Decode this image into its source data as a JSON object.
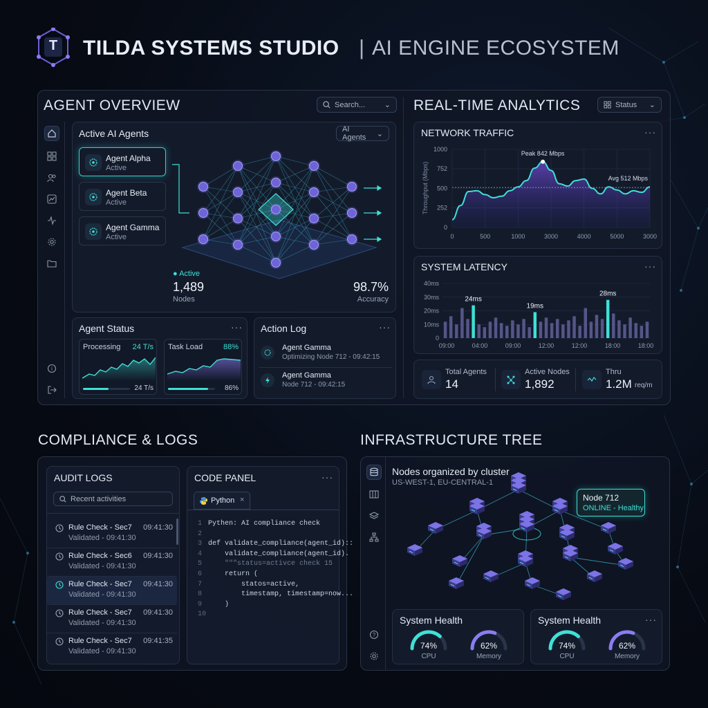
{
  "header": {
    "brand": "TILDA SYSTEMS STUDIO",
    "separator": "|",
    "subtitle": "AI ENGINE ECOSYSTEM",
    "logo_letter": "T"
  },
  "agent_overview": {
    "title": "AGENT OVERVIEW",
    "search_placeholder": "Search...",
    "active_agents_title": "Active AI Agents",
    "filter_label": "AI Agents",
    "agents": [
      {
        "name": "Agent Alpha",
        "state": "Active"
      },
      {
        "name": "Agent Beta",
        "state": "Active"
      },
      {
        "name": "Agent Gamma",
        "state": "Active"
      }
    ],
    "active_label": "Active",
    "nodes_value": "1,489",
    "nodes_label": "Nodes",
    "accuracy_value": "98.7%",
    "accuracy_label": "Accuracy"
  },
  "agent_status": {
    "title": "Agent Status",
    "processing": {
      "label": "Processing",
      "value": "24 T/s",
      "footer": "24 T/s",
      "fill": 0.55
    },
    "task_load": {
      "label": "Task Load",
      "value": "88%",
      "footer": "86%",
      "fill": 0.86
    }
  },
  "action_log": {
    "title": "Action Log",
    "entries": [
      {
        "name": "Agent Gamma",
        "detail": "Optimizing Node 712 - 09:42:15"
      },
      {
        "name": "Agent Gamma",
        "detail": "Node 712 - 09:42:15"
      }
    ]
  },
  "analytics": {
    "title": "REAL-TIME ANALYTICS",
    "status_label": "Status"
  },
  "network_traffic": {
    "title": "NETWORK TRAFFIC",
    "ylabel": "Throughput (Mbps)",
    "peak_label": "Peak 842 Mbps",
    "avg_label": "Avg 512 Mbps"
  },
  "system_latency": {
    "title": "SYSTEM LATENCY",
    "labels": [
      "24ms",
      "19ms",
      "28ms"
    ]
  },
  "stats": [
    {
      "label": "Total Agents",
      "value": "14",
      "unit": ""
    },
    {
      "label": "Active Nodes",
      "value": "1,892",
      "unit": ""
    },
    {
      "label": "Thru",
      "value": "1.2M",
      "unit": "req/m"
    }
  ],
  "compliance": {
    "title": "COMPLIANCE & LOGS"
  },
  "audit": {
    "title": "AUDIT LOGS",
    "search_placeholder": "Recent activities",
    "rows": [
      {
        "title": "Rule Check - Sec7",
        "sub": "Validated - 09:41:30",
        "time": "09:41:30"
      },
      {
        "title": "Rule Check - Sec6",
        "sub": "Validated - 09:41:30",
        "time": "09:41:30"
      },
      {
        "title": "Rule Check - Sec7",
        "sub": "Validated - 09:41:30",
        "time": "09:41:30"
      },
      {
        "title": "Rule Check - Sec7",
        "sub": "Validated - 09:41:30",
        "time": "09:41:30"
      },
      {
        "title": "Rule Check - Sec7",
        "sub": "Validated - 09:41:30",
        "time": "09:41:35"
      }
    ]
  },
  "code_panel": {
    "title": "CODE PANEL",
    "tab": "Python",
    "tab_close": "×",
    "lines": [
      "Pythen: AI compliance check",
      "",
      "def validate_compliance(agent_id)::",
      "    validate_compliance(agent_id).",
      "    \"\"\"status=activce check 15",
      "    return (",
      "        statos=active,",
      "        timestamp, timestamp=now...",
      "    )",
      ""
    ]
  },
  "infrastructure": {
    "title": "INFRASTRUCTURE TREE",
    "subtitle": "Nodes organized by cluster",
    "regions": "US-WEST-1, EU-CENTRAL-1",
    "node_name": "Node 712",
    "node_status": "ONLINE - Healthy"
  },
  "health": [
    {
      "title": "System Health",
      "cpu": "74%",
      "cpu_label": "CPU",
      "cpu_fill": 0.74,
      "mem": "62%",
      "mem_label": "Memory",
      "mem_fill": 0.62
    },
    {
      "title": "System Health",
      "cpu": "74%",
      "cpu_label": "CPU",
      "cpu_fill": 0.74,
      "mem": "62%",
      "mem_label": "Memory",
      "mem_fill": 0.62
    }
  ],
  "colors": {
    "accent": "#3fe0d6",
    "purple": "#8b7cf2",
    "bg": "#070b14"
  },
  "chart_data": [
    {
      "type": "area",
      "title": "NETWORK TRAFFIC",
      "ylabel": "Throughput (Mbps)",
      "x": [
        0,
        250,
        500,
        750,
        1000,
        1250,
        1500,
        1750,
        2000,
        2250,
        2500,
        2750,
        3000,
        3250,
        3500,
        3750,
        4000,
        4250,
        4500,
        4750,
        5000,
        5250,
        5500,
        5750,
        6000
      ],
      "values": [
        100,
        280,
        460,
        470,
        420,
        380,
        400,
        470,
        520,
        600,
        760,
        842,
        730,
        560,
        530,
        600,
        620,
        500,
        430,
        520,
        480,
        430,
        470,
        450,
        520
      ],
      "xticks": [
        "0",
        "500",
        "1000",
        "3000",
        "4000",
        "5000",
        "3000"
      ],
      "yticks": [
        "0",
        "252",
        "500",
        "752",
        "1000"
      ],
      "ylim": [
        0,
        1000
      ],
      "annotations": [
        "Peak 842 Mbps",
        "Avg 512 Mbps"
      ],
      "avg": 512
    },
    {
      "type": "bar",
      "title": "SYSTEM LATENCY",
      "values": [
        12,
        16,
        10,
        22,
        14,
        24,
        10,
        8,
        12,
        15,
        11,
        9,
        13,
        10,
        14,
        8,
        19,
        12,
        15,
        11,
        14,
        10,
        13,
        16,
        9,
        22,
        12,
        17,
        14,
        28,
        18,
        13,
        10,
        15,
        11,
        9,
        12
      ],
      "highlight": [
        5,
        16,
        29
      ],
      "xticks": [
        "09:00",
        "04:00",
        "09:00",
        "12:00",
        "12:00",
        "18:00",
        "18:00"
      ],
      "yticks": [
        "0",
        "10ms",
        "20ms",
        "30ms",
        "40ms"
      ],
      "ylim": [
        0,
        40
      ]
    }
  ]
}
